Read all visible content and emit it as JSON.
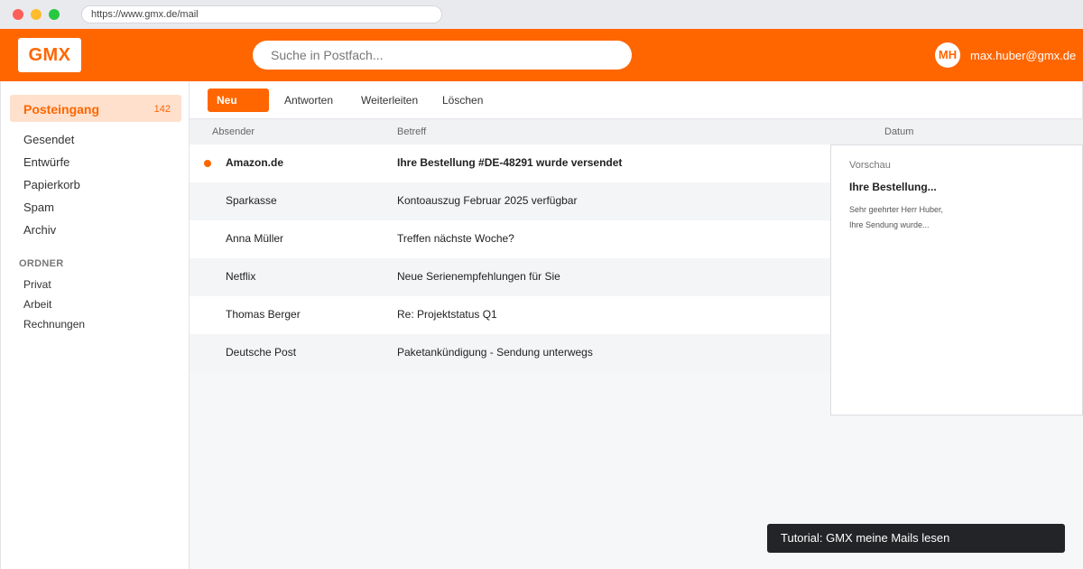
{
  "browser": {
    "url": "https://www.gmx.de/mail"
  },
  "header": {
    "logo": "GMX",
    "search_placeholder": "Suche in Postfach...",
    "avatar_initials": "MH",
    "user_email": "max.huber@gmx.de"
  },
  "sidebar": {
    "active": {
      "label": "Posteingang",
      "count": "142"
    },
    "items": [
      {
        "label": "Gesendet"
      },
      {
        "label": "Entwürfe"
      },
      {
        "label": "Papierkorb"
      },
      {
        "label": "Spam"
      },
      {
        "label": "Archiv"
      }
    ],
    "folders_title": "ORDNER",
    "folders": [
      {
        "label": "Privat"
      },
      {
        "label": "Arbeit"
      },
      {
        "label": "Rechnungen"
      }
    ]
  },
  "toolbar": {
    "new_label": "Neu",
    "reply_label": "Antworten",
    "forward_label": "Weiterleiten",
    "delete_label": "Löschen"
  },
  "mail_list": {
    "columns": {
      "sender": "Absender",
      "subject": "Betreff",
      "date": "Datum"
    },
    "rows": [
      {
        "sender": "Amazon.de",
        "subject": "Ihre Bestellung #DE-48291 wurde versendet",
        "unread": true
      },
      {
        "sender": "Sparkasse",
        "subject": "Kontoauszug Februar 2025 verfügbar",
        "unread": false
      },
      {
        "sender": "Anna Müller",
        "subject": "Treffen nächste Woche?",
        "unread": false
      },
      {
        "sender": "Netflix",
        "subject": "Neue Serienempfehlungen für Sie",
        "unread": false
      },
      {
        "sender": "Thomas Berger",
        "subject": "Re: Projektstatus Q1",
        "unread": false
      },
      {
        "sender": "Deutsche Post",
        "subject": "Paketankündigung - Sendung unterwegs",
        "unread": false
      }
    ]
  },
  "preview": {
    "label": "Vorschau",
    "title": "Ihre Bestellung...",
    "line1": "Sehr geehrter Herr Huber,",
    "line2": "Ihre Sendung wurde..."
  },
  "toast": {
    "text": "Tutorial: GMX meine Mails lesen"
  },
  "colors": {
    "brand": "#ff6600",
    "active_bg": "#ffe0cc",
    "toast_bg": "#232427"
  }
}
